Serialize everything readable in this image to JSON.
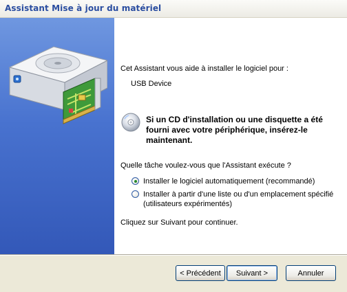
{
  "window": {
    "title": "Assistant Mise à jour du matériel"
  },
  "content": {
    "intro": "Cet Assistant vous aide à installer le logiciel pour :",
    "device_name": "USB Device",
    "cd_notice": "Si un CD d'installation ou une disquette a été fourni avec votre périphérique, insérez-le maintenant.",
    "question": "Quelle tâche voulez-vous que l'Assistant exécute ?",
    "options": [
      {
        "label": "Installer le logiciel automatiquement (recommandé)",
        "selected": true
      },
      {
        "label": "Installer à partir d'une liste ou d'un emplacement spécifié",
        "label2": "(utilisateurs expérimentés)",
        "selected": false
      }
    ],
    "continue_text": "Cliquez sur Suivant pour continuer."
  },
  "buttons": {
    "back": "< Précédent",
    "next": "Suivant >",
    "cancel": "Annuler"
  },
  "icons": {
    "side": "hardware-device-icon",
    "cd": "cd-disc-icon"
  },
  "colors": {
    "title_text": "#2a4da0",
    "side_panel": "#4872cf",
    "dialog_bg": "#ece9d8"
  }
}
